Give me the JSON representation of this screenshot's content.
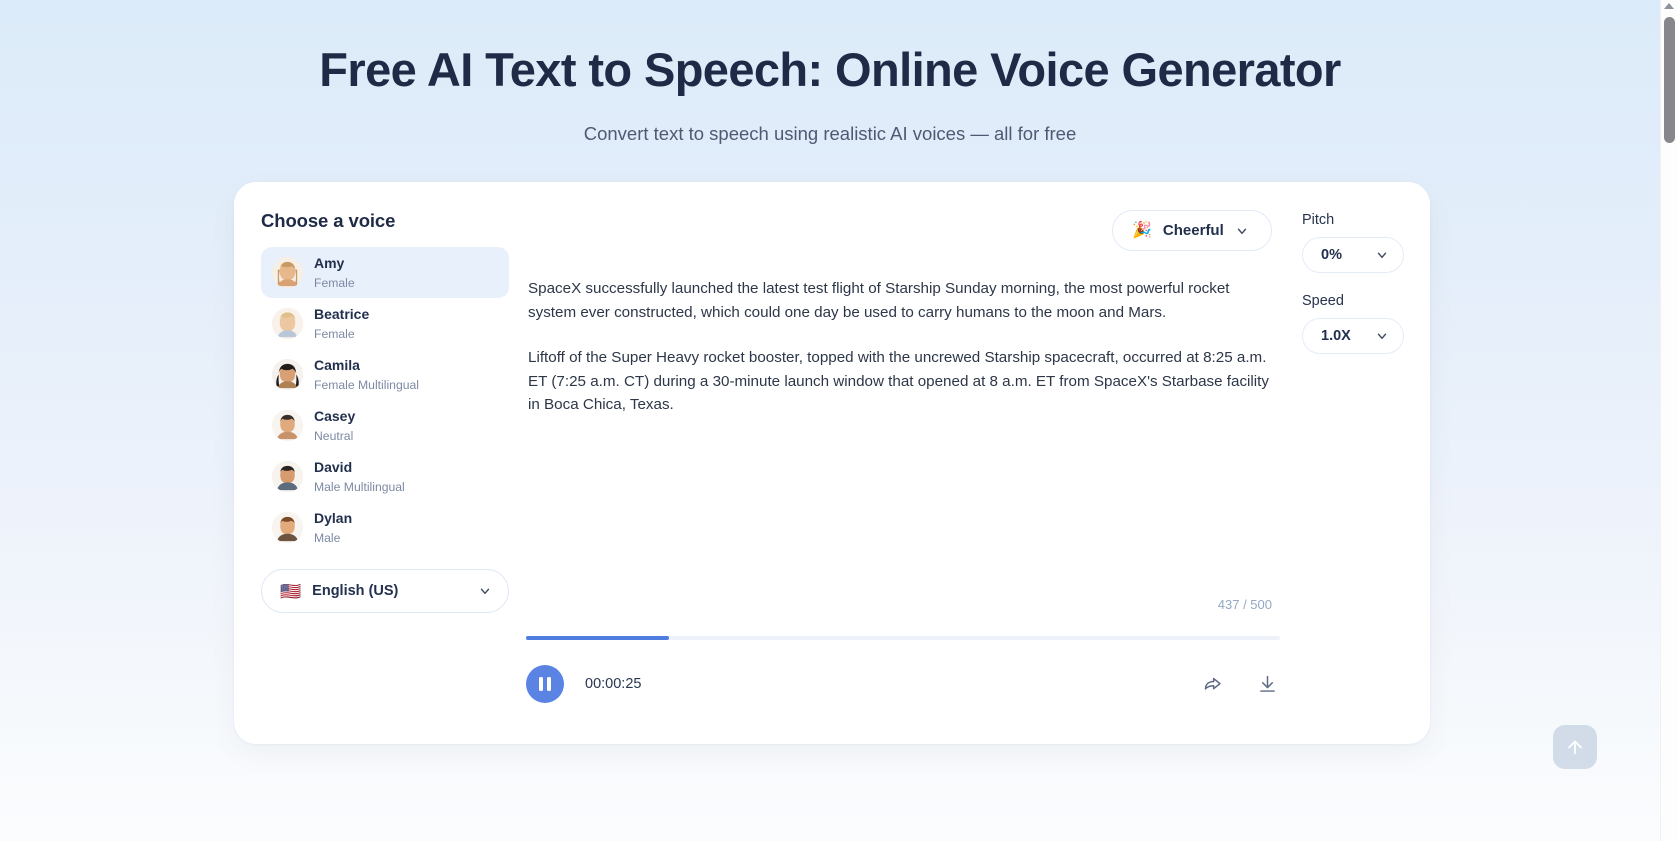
{
  "hero": {
    "title": "Free AI Text to Speech: Online Voice Generator",
    "subtitle": "Convert text to speech using realistic AI voices — all for free"
  },
  "voice_panel": {
    "heading": "Choose a voice",
    "selected_voice": "Amy",
    "voices": [
      {
        "name": "Amy",
        "tag": "Female"
      },
      {
        "name": "Beatrice",
        "tag": "Female"
      },
      {
        "name": "Camila",
        "tag": "Female Multilingual"
      },
      {
        "name": "Casey",
        "tag": "Neutral"
      },
      {
        "name": "David",
        "tag": "Male Multilingual"
      },
      {
        "name": "Dylan",
        "tag": "Male"
      }
    ],
    "language": {
      "flag": "🇺🇸",
      "label": "English (US)",
      "chevron_icon": "chevron-down-icon"
    }
  },
  "tone": {
    "emoji": "🎉",
    "label": "Cheerful",
    "chevron_icon": "chevron-down-icon"
  },
  "editor": {
    "paragraph_1": "SpaceX successfully launched the latest test flight of Starship Sunday morning, the most powerful rocket system ever constructed, which could one day be used to carry humans to the moon and Mars.",
    "paragraph_2": "Liftoff of the Super Heavy rocket booster, topped with the uncrewed Starship spacecraft, occurred at 8:25 a.m. ET (7:25 a.m. CT) during a 30-minute launch window that opened at 8 a.m. ET from SpaceX's Starbase facility in Boca Chica, Texas.",
    "char_count": "437 / 500"
  },
  "player": {
    "state_icon": "pause-icon",
    "time": "00:00:25",
    "progress_percent": 19,
    "share_icon": "share-icon",
    "download_icon": "download-icon"
  },
  "settings": {
    "pitch_label": "Pitch",
    "pitch_value": "0%",
    "speed_label": "Speed",
    "speed_value": "1.0X",
    "chevron_icon": "chevron-down-icon"
  },
  "scroll_to_top": {
    "icon": "arrow-up-icon"
  },
  "colors": {
    "accent_blue": "#5b83e4",
    "progress_fill": "#4f7ce0",
    "heading_navy": "#1e2a46",
    "selected_row": "#e8f0fb"
  }
}
